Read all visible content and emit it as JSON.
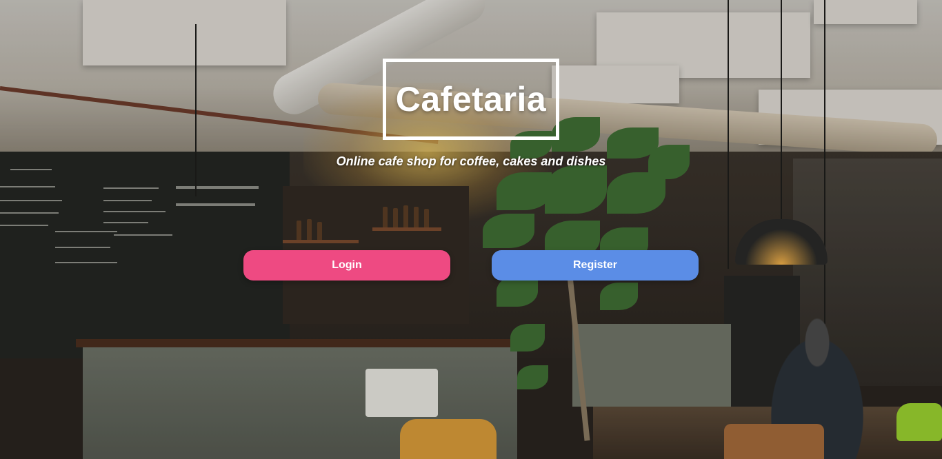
{
  "header": {
    "title": "Cafetaria",
    "subtitle": "Online cafe shop for coffee, cakes and dishes"
  },
  "actions": {
    "login_label": "Login",
    "register_label": "Register"
  },
  "colors": {
    "login_button": "#ee4a82",
    "register_button": "#5b8de6",
    "title_text": "#ffffff"
  },
  "background": {
    "icon": "cafe-interior-photo"
  }
}
